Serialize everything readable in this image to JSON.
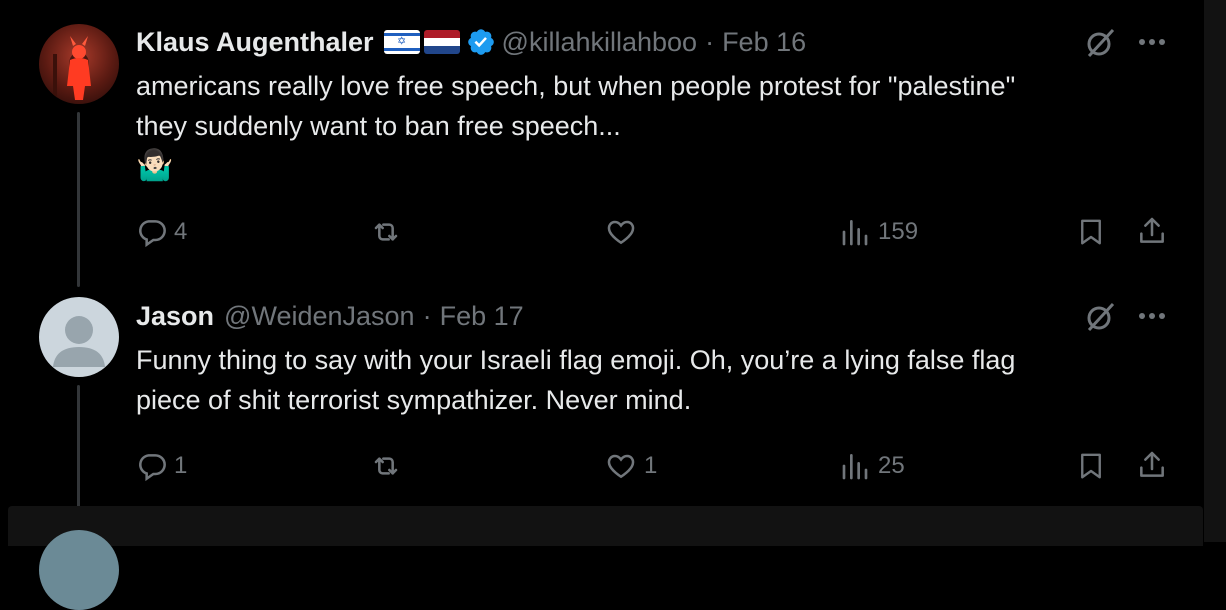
{
  "tweets": [
    {
      "name": "Klaus Augenthaler",
      "handle": "@killahkillahboo",
      "separator": "·",
      "date": "Feb 16",
      "text_lines": [
        "americans really love free speech, but when people protest for \"palestine\"",
        "they suddenly want to ban free speech..."
      ],
      "emoji": "🤷🏻‍♂️",
      "replies": "4",
      "reposts": "",
      "likes": "",
      "views": "159"
    },
    {
      "name": "Jason",
      "handle": "@WeidenJason",
      "separator": "·",
      "date": "Feb 17",
      "text_lines": [
        "Funny thing to say with your Israeli flag emoji.  Oh, you’re a lying false flag",
        "piece of shit terrorist sympathizer.  Never mind."
      ],
      "replies": "1",
      "reposts": "",
      "likes": "1",
      "views": "25"
    }
  ],
  "icons": {
    "reply": "reply-icon",
    "repost": "repost-icon",
    "like": "heart-icon",
    "views": "views-icon",
    "bookmark": "bookmark-icon",
    "share": "share-icon",
    "more": "more-icon",
    "grok": "grok-icon",
    "verified": "verified-badge-icon"
  },
  "colors": {
    "background": "#000000",
    "text": "#e7e9ea",
    "muted": "#71767b",
    "verified": "#1d9bf0",
    "line": "#333639"
  }
}
